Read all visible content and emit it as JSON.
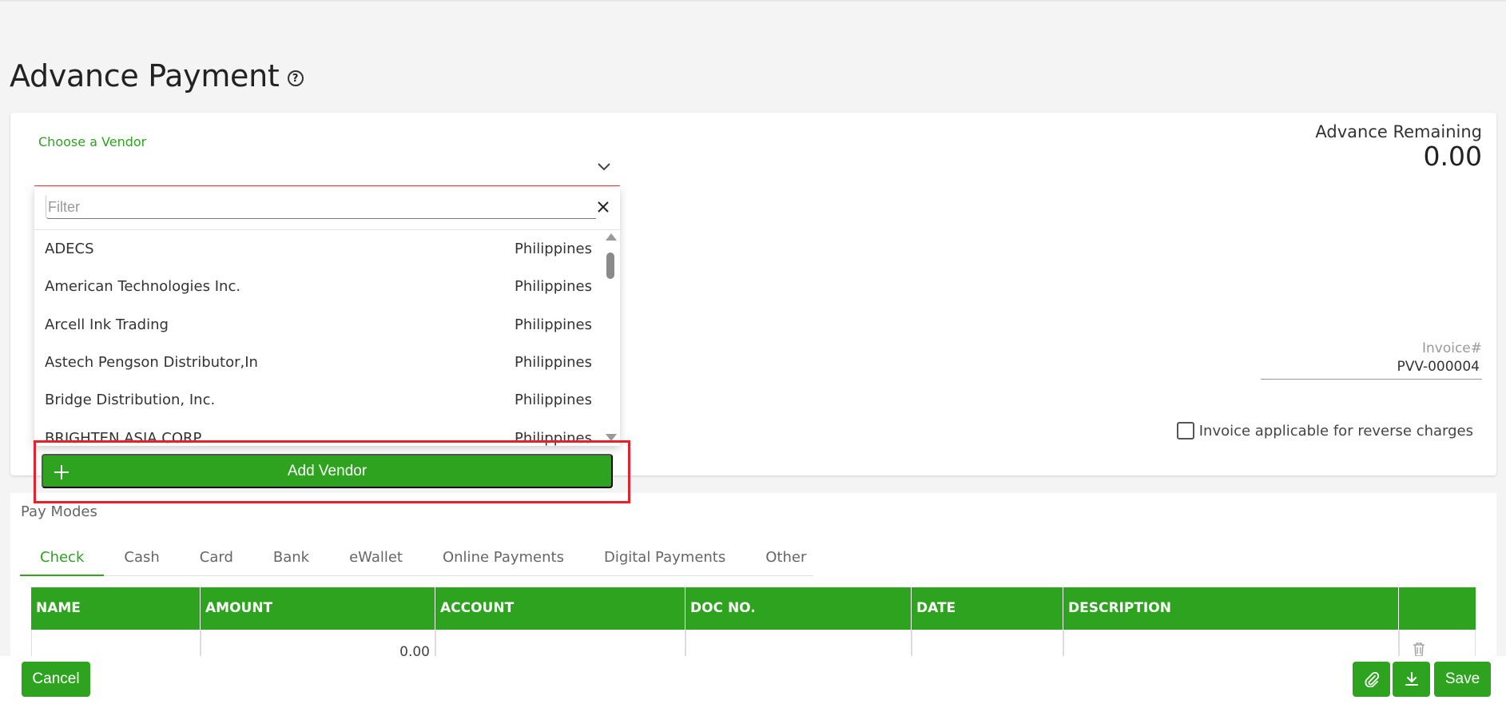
{
  "page": {
    "title": "Advance Payment",
    "help_icon": "help-circle-icon"
  },
  "vendor": {
    "label": "Choose a Vendor",
    "value": "",
    "chevron_icon": "chevron-down-icon"
  },
  "advance": {
    "label": "Advance Remaining",
    "value": "0.00"
  },
  "invoice": {
    "label": "Invoice#",
    "value": "PVV-000004"
  },
  "reverse_charge": {
    "label": "Invoice applicable for reverse charges",
    "checked": false
  },
  "dropdown": {
    "filter_placeholder": "Filter",
    "filter_value": "",
    "clear_icon": "close-icon",
    "items": [
      {
        "name": "ADECS",
        "country": "Philippines"
      },
      {
        "name": "American Technologies Inc.",
        "country": "Philippines"
      },
      {
        "name": "Arcell Ink Trading",
        "country": "Philippines"
      },
      {
        "name": "Astech Pengson Distributor,In",
        "country": "Philippines"
      },
      {
        "name": "Bridge Distribution, Inc.",
        "country": "Philippines"
      },
      {
        "name": "BRIGHTEN ASIA CORP",
        "country": "Philippines"
      }
    ],
    "add_button_label": "Add Vendor",
    "add_icon": "plus-icon"
  },
  "paymodes": {
    "label": "Pay Modes",
    "tabs": [
      "Check",
      "Cash",
      "Card",
      "Bank",
      "eWallet",
      "Online Payments",
      "Digital Payments",
      "Other"
    ],
    "active_tab": "Check"
  },
  "grid": {
    "columns": [
      "NAME",
      "AMOUNT",
      "ACCOUNT",
      "DOC NO.",
      "DATE",
      "DESCRIPTION",
      ""
    ],
    "rows": [
      {
        "name": "",
        "amount": "0.00",
        "account": "",
        "doc_no": "",
        "date": "",
        "description": ""
      }
    ],
    "delete_icon": "trash-icon"
  },
  "footer": {
    "cancel_label": "Cancel",
    "attach_icon": "paperclip-icon",
    "download_icon": "download-icon",
    "save_label": "Save"
  },
  "colors": {
    "accent": "#2ea31f",
    "error_underline": "#e53935",
    "highlight": "#e8202a"
  }
}
